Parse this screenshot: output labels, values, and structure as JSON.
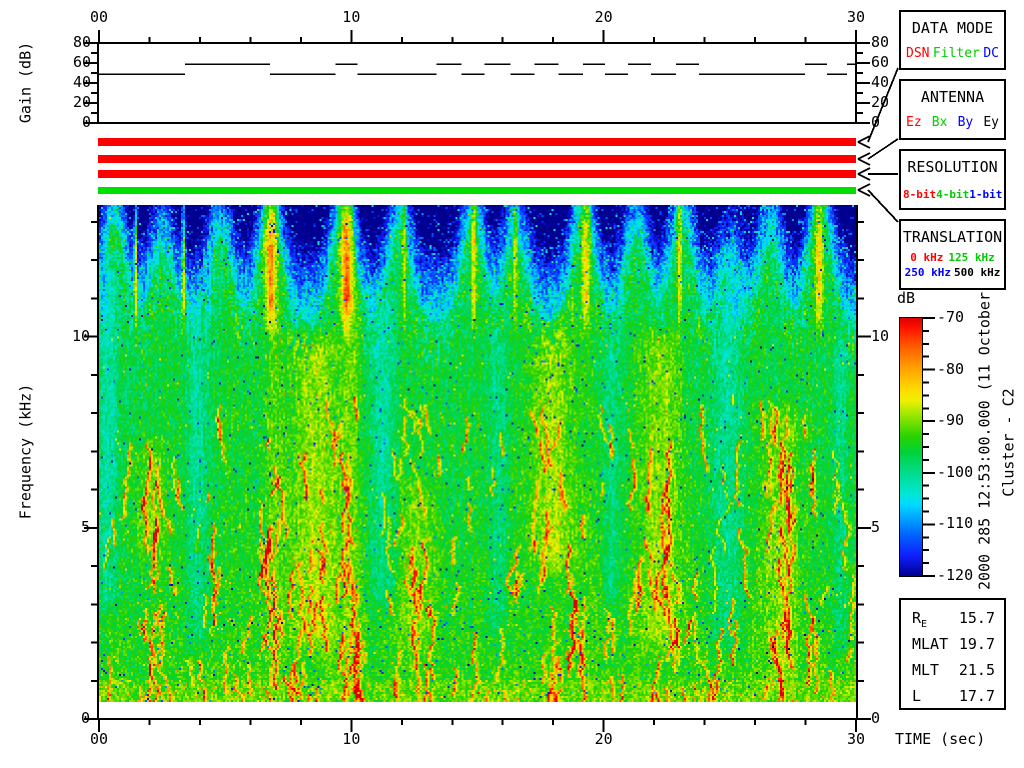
{
  "header": {
    "timestamp": "2000 285 12:53:00.000 (11 October)",
    "spacecraft_label": "Cluster - C2"
  },
  "axes": {
    "time_label": "TIME (sec)",
    "time_tick_labels": [
      "00",
      "10",
      "20",
      "30"
    ],
    "gain_ylabel": "Gain (dB)",
    "gain_tick_labels": [
      "80",
      "60",
      "40",
      "20",
      "0"
    ],
    "freq_ylabel": "Frequency (kHz)",
    "freq_tick_labels": [
      "10",
      "5",
      "0"
    ]
  },
  "colorbar": {
    "label": "dB",
    "tick_labels": [
      "-70",
      "-80",
      "-90",
      "-100",
      "-110",
      "-120"
    ]
  },
  "status_bars": [
    {
      "name": "data-mode-bar",
      "color": "#ff0000"
    },
    {
      "name": "antenna-bar",
      "color": "#ff0000"
    },
    {
      "name": "resolution-bar",
      "color": "#ff0000"
    },
    {
      "name": "translation-bar",
      "color": "#00e000"
    }
  ],
  "panels": [
    {
      "title": "DATA MODE",
      "rows": [
        [
          {
            "label": "DSN",
            "color": "#ff0000"
          },
          {
            "label": "Filter",
            "color": "#00cc00"
          },
          {
            "label": "DC",
            "color": "#0000ff"
          }
        ]
      ]
    },
    {
      "title": "ANTENNA",
      "rows": [
        [
          {
            "label": "Ez",
            "color": "#ff0000"
          },
          {
            "label": "Bx",
            "color": "#00cc00"
          },
          {
            "label": "By",
            "color": "#0000ff"
          },
          {
            "label": "Ey",
            "color": "#000000"
          }
        ]
      ]
    },
    {
      "title": "RESOLUTION",
      "rows": [
        [
          {
            "label": "8-bit",
            "color": "#ff0000"
          },
          {
            "label": "4-bit",
            "color": "#00cc00"
          },
          {
            "label": "1-bit",
            "color": "#0000ff"
          }
        ]
      ]
    },
    {
      "title": "TRANSLATION",
      "rows": [
        [
          {
            "label": "0 kHz",
            "color": "#ff0000"
          },
          {
            "label": "125 kHz",
            "color": "#00cc00"
          }
        ],
        [
          {
            "label": "250 kHz",
            "color": "#0000ff"
          },
          {
            "label": "500 kHz",
            "color": "#000000"
          }
        ]
      ]
    }
  ],
  "ephemeris": {
    "rows": [
      {
        "label": "R",
        "sub": "E",
        "value": "15.7"
      },
      {
        "label": "MLAT",
        "sub": "",
        "value": "19.7"
      },
      {
        "label": "MLT",
        "sub": "",
        "value": "21.5"
      },
      {
        "label": "L",
        "sub": "",
        "value": "17.7"
      }
    ]
  },
  "chart_data": {
    "type": "heatmap",
    "title": "Cluster - C2 wideband spectrogram",
    "x": {
      "label": "TIME (sec)",
      "range_sec": [
        0,
        30
      ],
      "major_ticks": [
        0,
        10,
        20,
        30
      ],
      "minor_step_sec": 2
    },
    "y": {
      "label": "Frequency (kHz)",
      "range_khz": [
        0,
        13.44
      ],
      "major_ticks": [
        0,
        5,
        10
      ],
      "minor_step_khz": 1,
      "data_min_khz": 0.45
    },
    "z": {
      "label": "dB",
      "range_db": [
        -120,
        -70
      ],
      "major_tick_step_db": 10,
      "minor_tick_step_db": 2.5
    },
    "colormap": [
      [
        -70,
        "#dc0000"
      ],
      [
        -72,
        "#ff1400"
      ],
      [
        -76,
        "#ff6400"
      ],
      [
        -80,
        "#ffa500"
      ],
      [
        -84,
        "#ffdc00"
      ],
      [
        -86,
        "#eef000"
      ],
      [
        -89,
        "#96e600"
      ],
      [
        -93,
        "#28d200"
      ],
      [
        -96,
        "#00d23c"
      ],
      [
        -100,
        "#00dc8c"
      ],
      [
        -104,
        "#00e6d2"
      ],
      [
        -106,
        "#00dcff"
      ],
      [
        -109,
        "#00a0ff"
      ],
      [
        -112,
        "#0064ff"
      ],
      [
        -116,
        "#0f1fff"
      ],
      [
        -120,
        "#000090"
      ]
    ],
    "gain_line": {
      "ylabel": "Gain (dB)",
      "range_db": [
        0,
        80
      ],
      "major_tick_step_db": 20,
      "levels_db": {
        "lo": 48.75,
        "hi": 58.75
      },
      "segments": [
        [
          0,
          3.4,
          "lo"
        ],
        [
          3.4,
          6.77,
          "hi"
        ],
        [
          6.77,
          9.38,
          "lo"
        ],
        [
          9.38,
          10.25,
          "hi"
        ],
        [
          10.25,
          13.38,
          "lo"
        ],
        [
          13.38,
          14.37,
          "hi"
        ],
        [
          14.37,
          15.28,
          "lo"
        ],
        [
          15.28,
          16.31,
          "hi"
        ],
        [
          16.31,
          17.26,
          "lo"
        ],
        [
          17.26,
          18.21,
          "hi"
        ],
        [
          18.21,
          19.19,
          "lo"
        ],
        [
          19.19,
          20.06,
          "hi"
        ],
        [
          20.06,
          20.97,
          "lo"
        ],
        [
          20.97,
          21.88,
          "hi"
        ],
        [
          21.88,
          22.87,
          "lo"
        ],
        [
          22.87,
          23.78,
          "hi"
        ],
        [
          23.78,
          27.98,
          "lo"
        ],
        [
          27.98,
          28.85,
          "hi"
        ],
        [
          28.85,
          29.64,
          "lo"
        ],
        [
          29.64,
          30,
          "hi"
        ]
      ]
    },
    "texture": {
      "seed": 42,
      "base_profile": [
        [
          0.45,
          -92.5
        ],
        [
          1,
          -93.5
        ],
        [
          4,
          -94.5
        ],
        [
          7,
          -95.5
        ],
        [
          10.5,
          -96
        ],
        [
          13.44,
          -97
        ]
      ],
      "plumes": [
        [
          0.6,
          0.85
        ],
        [
          2.5,
          0.6
        ],
        [
          4.8,
          0.75
        ],
        [
          6.8,
          1.0
        ],
        [
          9.7,
          1.0
        ],
        [
          11.9,
          0.8
        ],
        [
          14.8,
          0.85
        ],
        [
          16.5,
          0.7
        ],
        [
          19.2,
          0.95
        ],
        [
          21.3,
          0.75
        ],
        [
          23.1,
          0.85
        ],
        [
          25.0,
          0.45
        ],
        [
          26.6,
          0.7
        ],
        [
          28.6,
          1.0
        ]
      ],
      "bright_streaks": [
        [
          1.45,
          0.06,
          13
        ],
        [
          3.35,
          0.08,
          12
        ],
        [
          6.8,
          0.2,
          15
        ],
        [
          9.8,
          0.22,
          16
        ],
        [
          12.1,
          0.07,
          10
        ],
        [
          14.85,
          0.1,
          12
        ],
        [
          16.5,
          0.06,
          10
        ],
        [
          19.3,
          0.16,
          12
        ],
        [
          23.0,
          0.09,
          11
        ],
        [
          28.55,
          0.16,
          14
        ]
      ],
      "dark_streaks": [
        [
          0.15,
          0.1,
          10
        ],
        [
          4.35,
          0.08,
          12
        ],
        [
          7.8,
          0.07,
          11
        ],
        [
          10.9,
          0.07,
          11
        ],
        [
          13.4,
          0.08,
          12
        ],
        [
          17.3,
          0.07,
          11
        ],
        [
          20.7,
          0.08,
          11
        ],
        [
          25.3,
          0.45,
          8
        ],
        [
          29.85,
          0.1,
          12
        ]
      ],
      "warm_bands": [
        [
          8.5,
          1.0,
          2,
          10,
          6
        ],
        [
          18.0,
          0.9,
          4,
          11,
          6
        ],
        [
          22.3,
          0.8,
          2,
          10,
          6
        ],
        [
          27.0,
          0.7,
          1,
          8,
          5
        ],
        [
          2.0,
          0.6,
          4.5,
          7,
          5
        ],
        [
          12.6,
          0.7,
          2,
          6,
          4
        ],
        [
          10.0,
          0.45,
          1,
          13,
          4
        ],
        [
          6.9,
          0.35,
          1,
          13,
          3
        ]
      ],
      "cyan_bands": [
        [
          0.35,
          0.45,
          3,
          12,
          -6
        ],
        [
          3.9,
          0.5,
          2,
          12,
          -5
        ],
        [
          11.3,
          0.5,
          3,
          11,
          -5
        ],
        [
          15.8,
          0.4,
          2,
          10,
          -4
        ],
        [
          24.9,
          0.6,
          2,
          11,
          -5
        ],
        [
          20.3,
          0.35,
          3,
          10,
          -4
        ],
        [
          29.4,
          0.3,
          2,
          10,
          -4
        ]
      ],
      "filaments": {
        "count": 280,
        "amp": [
          11,
          21
        ],
        "len_khz": [
          0.3,
          2.0
        ]
      }
    }
  }
}
